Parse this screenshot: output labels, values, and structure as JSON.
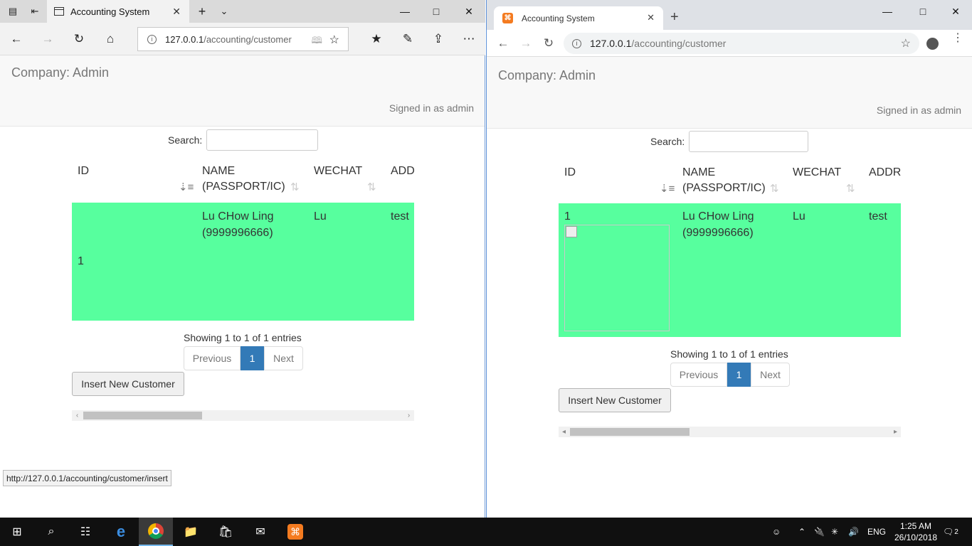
{
  "edge": {
    "tab_title": "Accounting System",
    "url_host": "127.0.0.1",
    "url_path": "/accounting/customer",
    "status_url": "http://127.0.0.1/accounting/customer/insert"
  },
  "chrome": {
    "tab_title": "Accounting System",
    "url_host": "127.0.0.1",
    "url_path": "/accounting/customer"
  },
  "header": {
    "company": "Company: Admin",
    "signed_in": "Signed in as admin"
  },
  "search": {
    "label": "Search:",
    "value": ""
  },
  "table": {
    "columns": [
      "ID",
      "NAME (PASSPORT/IC)",
      "WECHAT",
      "ADDR"
    ],
    "edge_last_column": "ADD",
    "rows": [
      {
        "id": "1",
        "name": "Lu CHow Ling (9999996666)",
        "wechat": "Lu",
        "address": "test"
      }
    ]
  },
  "pagination": {
    "info": "Showing 1 to 1 of 1 entries",
    "previous": "Previous",
    "current": "1",
    "next": "Next"
  },
  "actions": {
    "insert": "Insert New Customer"
  },
  "taskbar": {
    "language": "ENG",
    "time": "1:25 AM",
    "date": "26/10/2018",
    "notifications": "2"
  },
  "colors": {
    "row_highlight": "#57ff9e",
    "pager_active": "#337ab7"
  }
}
